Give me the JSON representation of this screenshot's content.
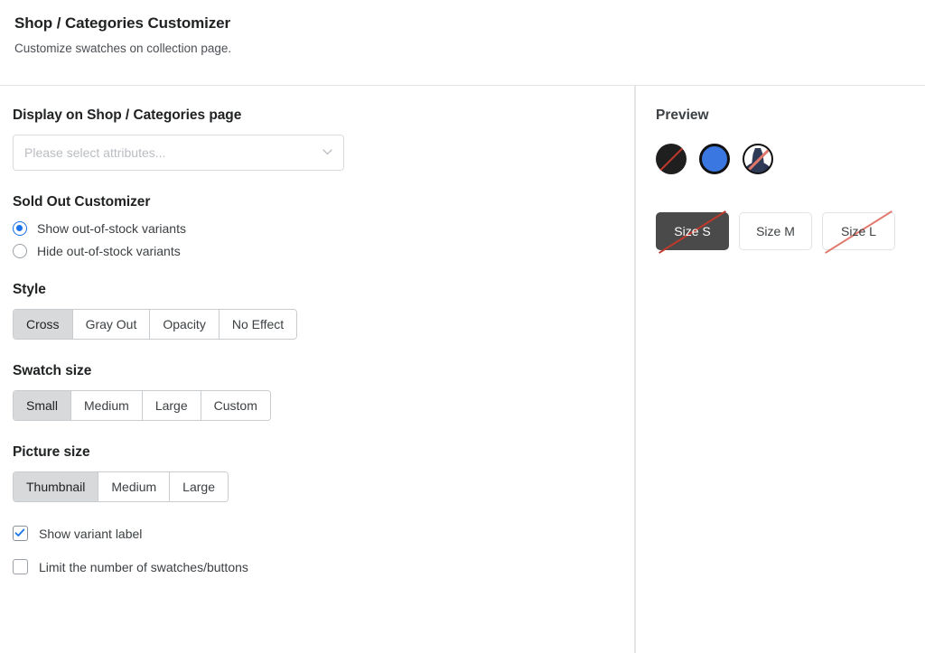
{
  "header": {
    "title": "Shop / Categories Customizer",
    "subtitle": "Customize swatches on collection page."
  },
  "display_section": {
    "title": "Display on Shop / Categories page",
    "select": {
      "placeholder": "Please select attributes...",
      "value": "",
      "chevron_icon": "chevron-down-icon"
    }
  },
  "sold_out_section": {
    "title": "Sold Out Customizer",
    "options": [
      {
        "label": "Show out-of-stock variants",
        "checked": true
      },
      {
        "label": "Hide out-of-stock variants",
        "checked": false
      }
    ]
  },
  "style_section": {
    "title": "Style",
    "options": [
      "Cross",
      "Gray Out",
      "Opacity",
      "No Effect"
    ],
    "selected": "Cross"
  },
  "swatch_size_section": {
    "title": "Swatch size",
    "options": [
      "Small",
      "Medium",
      "Large",
      "Custom"
    ],
    "selected": "Small"
  },
  "picture_size_section": {
    "title": "Picture size",
    "options": [
      "Thumbnail",
      "Medium",
      "Large"
    ],
    "selected": "Thumbnail"
  },
  "checkboxes": [
    {
      "label": "Show variant label",
      "checked": true,
      "icon": "checkmark-icon"
    },
    {
      "label": "Limit the number of swatches/buttons",
      "checked": false
    }
  ],
  "preview": {
    "title": "Preview",
    "swatches": [
      {
        "name": "black-swatch",
        "kind": "color",
        "color": "#1f1f1f",
        "crossed": true,
        "selected": false
      },
      {
        "name": "blue-swatch",
        "kind": "color",
        "color": "#3a77e0",
        "crossed": false,
        "selected": true
      },
      {
        "name": "picture-swatch",
        "kind": "image",
        "color": "#2f3a57",
        "crossed": true,
        "selected": false
      }
    ],
    "size_buttons": [
      {
        "label": "Size S",
        "selected": true,
        "crossed": true
      },
      {
        "label": "Size M",
        "selected": false,
        "crossed": false
      },
      {
        "label": "Size L",
        "selected": false,
        "crossed": true
      }
    ]
  },
  "colors": {
    "accent_blue": "#1a73e8",
    "cross_red": "#c0392b",
    "selected_dark": "#4a4a4a",
    "segment_active": "#d7d9db",
    "border": "#e3e5e7"
  }
}
